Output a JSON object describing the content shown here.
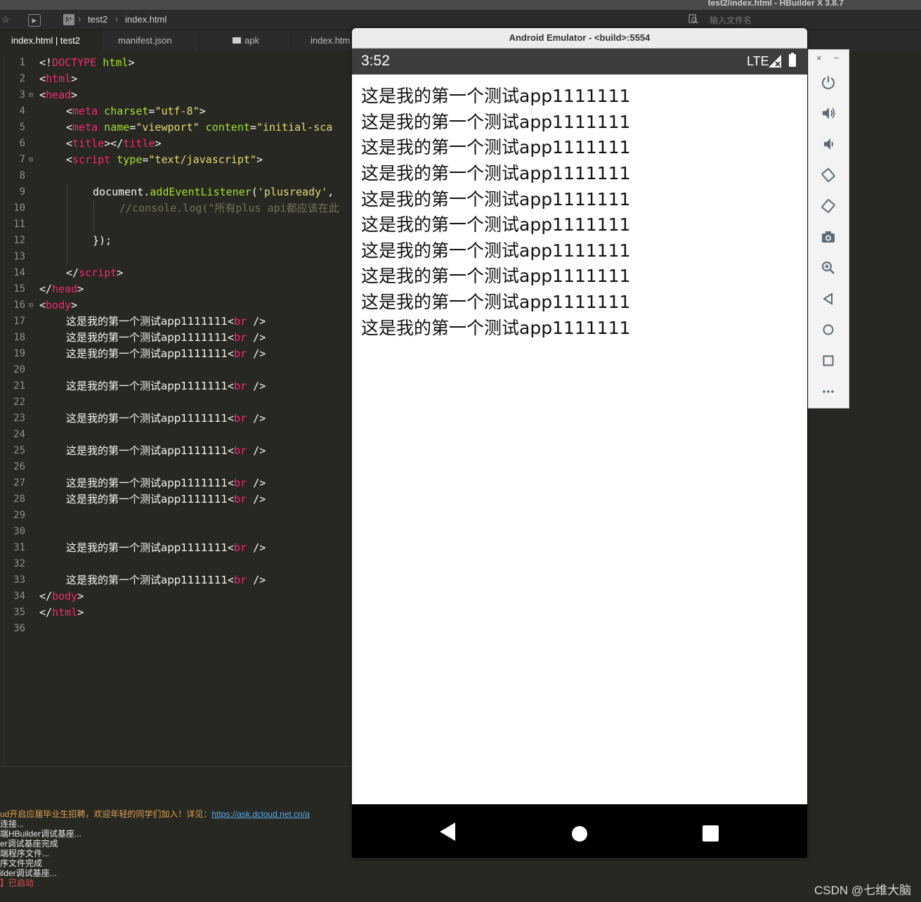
{
  "window": {
    "title": "test2/index.html - HBuilder X 3.8.7"
  },
  "toolbar": {
    "breadcrumb": [
      "test2",
      "index.html"
    ],
    "search_placeholder": "输入文件名"
  },
  "tabs": [
    {
      "label": "index.html | test2",
      "active": true
    },
    {
      "label": "manifest.json",
      "active": false
    },
    {
      "label": "apk",
      "active": false,
      "icon": "folder-icon"
    },
    {
      "label": "index.htm",
      "active": false
    }
  ],
  "editor": {
    "line_numbers": [
      "1",
      "2",
      "3",
      "4",
      "5",
      "6",
      "7",
      "8",
      "9",
      "10",
      "11",
      "12",
      "13",
      "14",
      "15",
      "16",
      "17",
      "18",
      "19",
      "20",
      "21",
      "22",
      "23",
      "24",
      "25",
      "26",
      "27",
      "28",
      "29",
      "30",
      "31",
      "32",
      "33",
      "34",
      "35",
      "36"
    ],
    "code": {
      "l1": {
        "a": "<!",
        "b": "DOCTYPE",
        "c": " html",
        "d": ">"
      },
      "l2": {
        "a": "<",
        "b": "html",
        "c": ">"
      },
      "l3": {
        "a": "<",
        "b": "head",
        "c": ">"
      },
      "l4": {
        "a": "<",
        "b": "meta",
        "c": " charset",
        "d": "=",
        "e": "\"utf-8\"",
        "f": ">"
      },
      "l5": {
        "a": "<",
        "b": "meta",
        "c": " name",
        "d": "=",
        "e": "\"viewport\"",
        "f": " content",
        "g": "=",
        "h": "\"initial-sca"
      },
      "l6": {
        "a": "<",
        "b": "title",
        "c": "></",
        "d": "title",
        "e": ">"
      },
      "l7": {
        "a": "<",
        "b": "script",
        "c": " type",
        "d": "=",
        "e": "\"text/javascript\"",
        "f": ">"
      },
      "l9": {
        "a": "document.",
        "b": "addEventListener",
        "c": "(",
        "d": "'plusready'",
        "e": ","
      },
      "l10": {
        "a": "//console.log(\"所有plus api都应该在此"
      },
      "l12": {
        "a": "});"
      },
      "l14": {
        "a": "</",
        "b": "script",
        "c": ">"
      },
      "l15": {
        "a": "</",
        "b": "head",
        "c": ">"
      },
      "l16": {
        "a": "<",
        "b": "body",
        "c": ">"
      },
      "body_text": "这是我的第一个测试app1111111",
      "br_open": "<",
      "br_tag": "br",
      "br_close": " />",
      "l34": {
        "a": "</",
        "b": "body",
        "c": ">"
      },
      "l35": {
        "a": "</",
        "b": "html",
        "c": ">"
      }
    }
  },
  "console": {
    "line1_text": "ud开启应届毕业生招聘，欢迎年轻的同学们加入！详见：",
    "line1_link": "https://ask.dcloud.net.cn/a",
    "lines": [
      "连接...",
      "端HBuilder调试基座...",
      "er调试基座完成",
      "端程序文件...",
      "序文件完成",
      "ilder调试基座...",
      "】已启动"
    ]
  },
  "emulator": {
    "title": "Android Emulator - <build>:5554",
    "status_time": "3:52",
    "network": "LTE",
    "app_lines": [
      "这是我的第一个测试app1111111",
      "这是我的第一个测试app1111111",
      "这是我的第一个测试app1111111",
      "这是我的第一个测试app1111111",
      "这是我的第一个测试app1111111",
      "这是我的第一个测试app1111111",
      "这是我的第一个测试app1111111",
      "这是我的第一个测试app1111111",
      "这是我的第一个测试app1111111",
      "这是我的第一个测试app1111111"
    ]
  },
  "side_panel": {
    "close": "×",
    "minimize": "−",
    "buttons": [
      "power-icon",
      "volume-up-icon",
      "volume-down-icon",
      "rotate-left-icon",
      "rotate-right-icon",
      "camera-icon",
      "zoom-icon",
      "back-icon",
      "home-icon",
      "overview-icon",
      "more-icon"
    ]
  },
  "watermark": "CSDN @七维大脑"
}
